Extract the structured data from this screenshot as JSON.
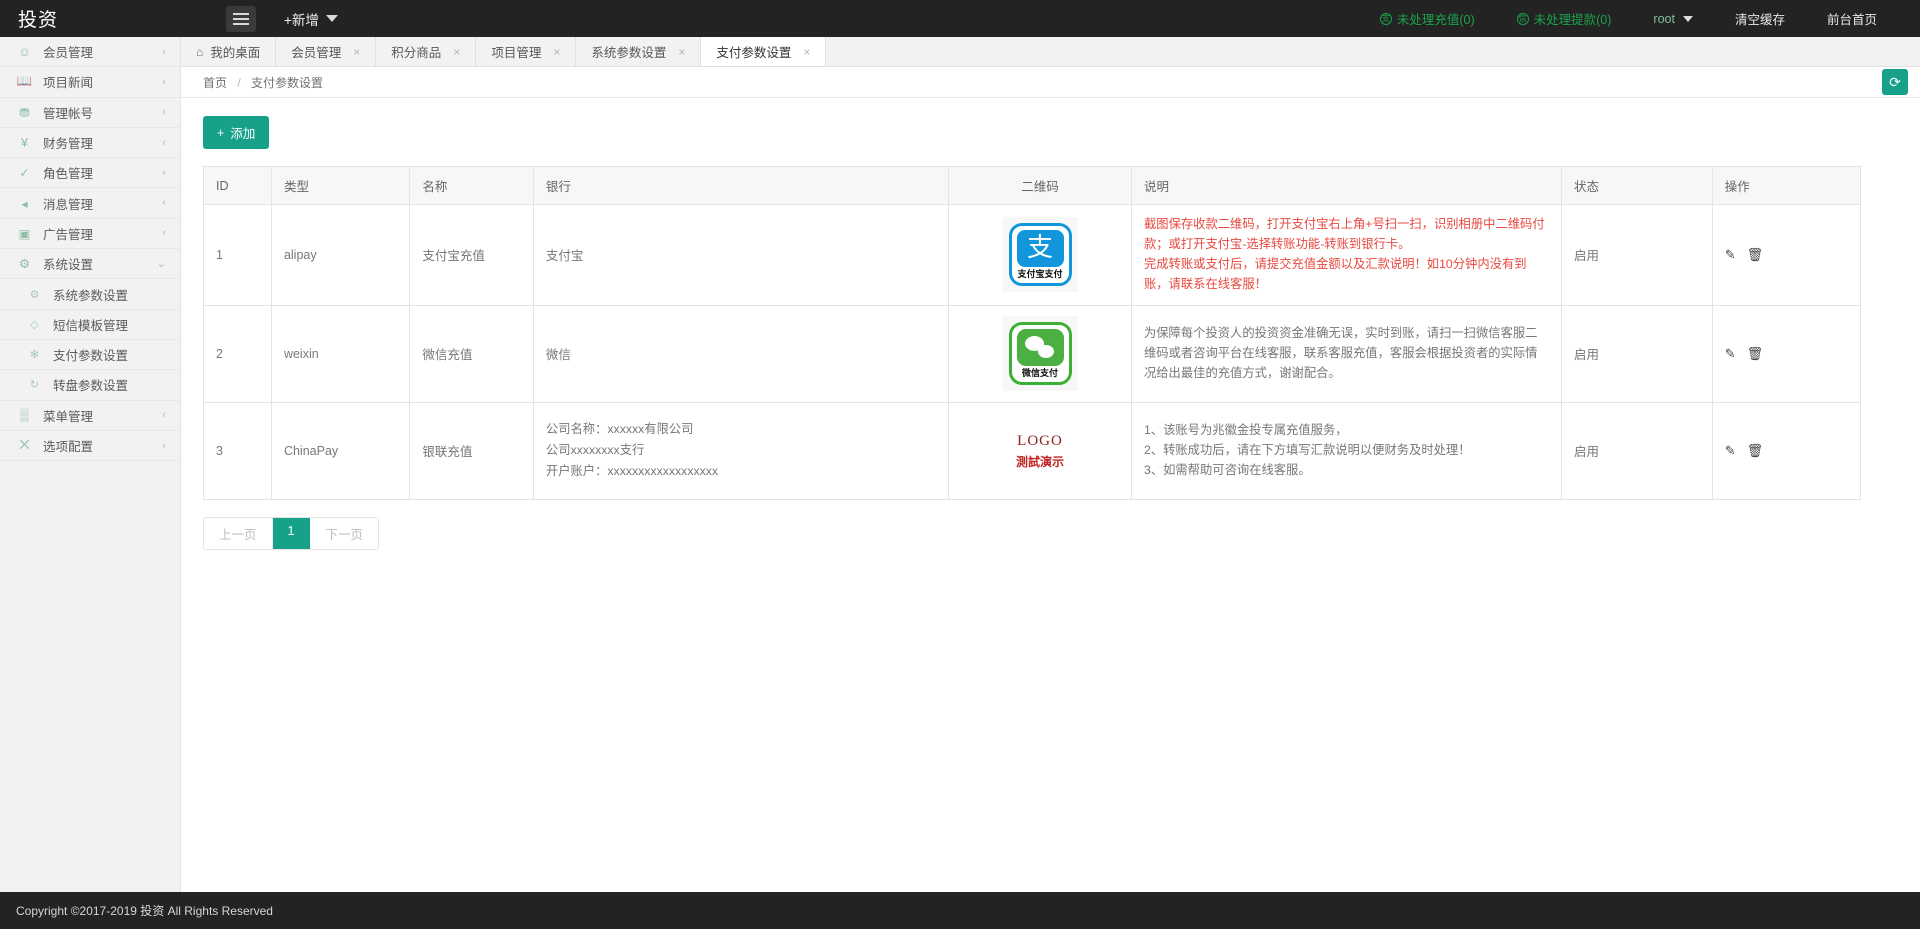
{
  "topbar": {
    "brand": "投资",
    "menu_toggle_icon": "hamburger-icon",
    "new_label": "+新增",
    "right_items": [
      {
        "label": "未处理充值(0)",
        "icon": "alipay-circle-icon",
        "color": "#1aa34a"
      },
      {
        "label": "未处理提款(0)",
        "icon": "wechat-circle-icon",
        "color": "#1aa34a"
      },
      {
        "label": "root",
        "icon": "caret-down-icon",
        "color": "#7fbf9a"
      },
      {
        "label": "清空缓存",
        "color": "#ffffff"
      },
      {
        "label": "前台首页",
        "color": "#ffffff"
      }
    ]
  },
  "sidebar": {
    "items": [
      {
        "label": "会员管理",
        "icon": "user-icon",
        "arrow": "‹",
        "sub": false
      },
      {
        "label": "项目新闻",
        "icon": "book-icon",
        "arrow": "‹",
        "sub": false
      },
      {
        "label": "管理帐号",
        "icon": "user-gear-icon",
        "arrow": "‹",
        "sub": false
      },
      {
        "label": "财务管理",
        "icon": "yen-circle-icon",
        "arrow": "‹",
        "sub": false
      },
      {
        "label": "角色管理",
        "icon": "shield-check-icon",
        "arrow": "‹",
        "sub": false
      },
      {
        "label": "消息管理",
        "icon": "speaker-icon",
        "arrow": "‹",
        "sub": false
      },
      {
        "label": "广告管理",
        "icon": "image-icon",
        "arrow": "‹",
        "sub": false
      },
      {
        "label": "系统设置",
        "icon": "gear-icon",
        "arrow": "⌄",
        "sub": false
      },
      {
        "label": "系统参数设置",
        "icon": "gear-small-icon",
        "arrow": "",
        "sub": true
      },
      {
        "label": "短信模板管理",
        "icon": "tag-icon",
        "arrow": "",
        "sub": true
      },
      {
        "label": "支付参数设置",
        "icon": "asterisk-circle-icon",
        "arrow": "",
        "sub": true
      },
      {
        "label": "转盘参数设置",
        "icon": "refresh-circle-icon",
        "arrow": "",
        "sub": true
      },
      {
        "label": "菜单管理",
        "icon": "grid-icon",
        "arrow": "‹",
        "sub": false
      },
      {
        "label": "选项配置",
        "icon": "sliders-icon",
        "arrow": "‹",
        "sub": false
      }
    ]
  },
  "tabs": [
    {
      "label": "我的桌面",
      "icon": "home-icon",
      "closable": false,
      "active": false
    },
    {
      "label": "会员管理",
      "icon": "",
      "closable": true,
      "active": false
    },
    {
      "label": "积分商品",
      "icon": "",
      "closable": true,
      "active": false
    },
    {
      "label": "项目管理",
      "icon": "",
      "closable": true,
      "active": false
    },
    {
      "label": "系统参数设置",
      "icon": "",
      "closable": true,
      "active": false
    },
    {
      "label": "支付参数设置",
      "icon": "",
      "closable": true,
      "active": true
    }
  ],
  "breadcrumb": {
    "home": "首页",
    "separator": "/",
    "current": "支付参数设置",
    "refresh_icon": "refresh-icon"
  },
  "toolbar": {
    "add_label": "添加",
    "add_icon": "plus-icon"
  },
  "table": {
    "columns": [
      "ID",
      "类型",
      "名称",
      "银行",
      "二维码",
      "说明",
      "状态",
      "操作"
    ],
    "rows": [
      {
        "id": "1",
        "type": "alipay",
        "name": "支付宝充值",
        "bank": "支付宝",
        "qr": {
          "kind": "alipay-logo",
          "caption": "支付宝支付",
          "glyph": "支"
        },
        "desc_lines": [
          "截图保存收款二维码，打开支付宝右上角+号扫一扫，识别相册中二维码付款；或打开支付宝-选择转账功能-转账到银行卡。",
          "完成转账或支付后，请提交充值金额以及汇款说明！如10分钟内没有到账，请联系在线客服！"
        ],
        "desc_color": "#e8483f",
        "status": "启用",
        "actions": [
          "edit-icon",
          "delete-icon"
        ]
      },
      {
        "id": "2",
        "type": "weixin",
        "name": "微信充值",
        "bank": "微信",
        "qr": {
          "kind": "wechat-logo",
          "caption": "微信支付",
          "glyph": ""
        },
        "desc_lines": [
          "为保障每个投资人的投资资金准确无误，实时到账，请扫一扫微信客服二维码或者咨询平台在线客服，联系客服充值，客服会根据投资者的实际情况给出最佳的充值方式，谢谢配合。"
        ],
        "desc_color": "#777777",
        "status": "启用",
        "actions": [
          "edit-icon",
          "delete-icon"
        ]
      },
      {
        "id": "3",
        "type": "ChinaPay",
        "name": "银联充值",
        "bank_lines": [
          "公司名称：xxxxxx有限公司",
          "公司xxxxxxxx支行",
          "开户账户：xxxxxxxxxxxxxxxxxx"
        ],
        "qr": {
          "kind": "text-logo",
          "line1": "LOGO",
          "line2": "測試演示"
        },
        "desc_lines": [
          "1、该账号为兆徽金投专属充值服务，",
          "2、转账成功后，请在下方填写汇款说明以便财务及时处理！",
          "3、如需帮助可咨询在线客服。"
        ],
        "desc_color": "#777777",
        "status": "启用",
        "actions": [
          "edit-icon",
          "delete-icon"
        ]
      }
    ]
  },
  "pagination": {
    "prev": "上一页",
    "pages": [
      "1"
    ],
    "next": "下一页",
    "current": "1"
  },
  "footer": {
    "copyright": "Copyright ©2017-2019 投资 All Rights Reserved"
  },
  "colors": {
    "accent": "#17a189",
    "topbar_bg": "#232323",
    "sidebar_bg": "#f2f2f2",
    "alert_red": "#e8483f",
    "green_badge": "#1aa34a"
  }
}
